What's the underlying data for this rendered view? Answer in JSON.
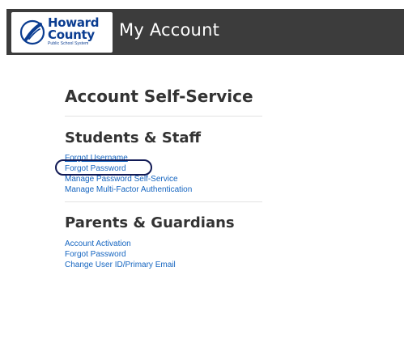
{
  "header": {
    "logo": {
      "line1": "Howard",
      "line2": "County",
      "subtitle": "Public School System"
    },
    "title": "My Account"
  },
  "main": {
    "title": "Account Self-Service",
    "sections": [
      {
        "title": "Students & Staff",
        "links": [
          "Forgot Username",
          "Forgot Password",
          "Manage Password Self-Service",
          "Manage Multi-Factor Authentication"
        ]
      },
      {
        "title": "Parents & Guardians",
        "links": [
          "Account Activation",
          "Forgot Password",
          "Change User ID/Primary Email"
        ]
      }
    ]
  },
  "colors": {
    "topbar": "#3c3c3c",
    "link": "#1565c0",
    "annotation_circle": "#111a55",
    "logo_blue": "#0b3d91"
  }
}
